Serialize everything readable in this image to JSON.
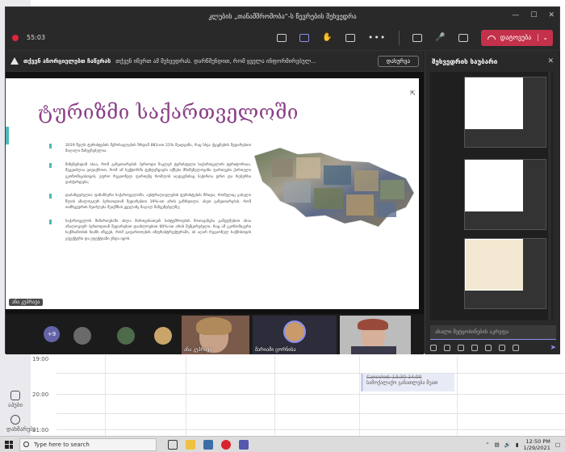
{
  "meeting": {
    "title": "კლუბის „თანამშრომობა“-ს წევრების შეხვედრა",
    "timer": "55:03",
    "leave_label": "დატოვება",
    "banner": {
      "bold": "თქვენ აჩორციელებთ ჩაწერას",
      "message": "თქვენ იწერთ ამ შეხვედრას. დარწმუნდით, რომ ყველა ინფორმირებულ...",
      "dismiss": "დახურვა"
    },
    "presenter_tag": "ანა კუპრავა"
  },
  "slide": {
    "title": "ტურიზმი საქართველოში",
    "bullets": [
      "2019 წელს ტურისტების შემოსავლების ზრდამ 883-ით 21% შეადგინა, რაც სხვა ქვეყნების შედარებით მაღალი მაჩვენებელია.",
      "მიზეზებიდან ისაა, რომ განვითარების პერიოდი ნაკლებ ტურისტული საქართველოს ტერიტორიაა, შეგვიძლია ვიფიქროთ, რომ ამ სექტორში ტენდენციები იქნება მნიშვნელოვანი ფართეები ქართული ეკონომიკისთვის, უფრო რეგიონულ ფართეზე რომლის აღდგენისაც საჭიროა დრო და რესურსი დასჭირდება;",
      "დაბანდებულია ფინანსური საქართველოში, ავსტრალიელების ტურისტების შრიდა, რომელიც გასული წლის ანალოგიურ პერიოდთან შედარებით 19%-ით არის გაზრდილი. ასეთ განვითარებას, რომ თანხვედრის შეიძლება შეიქმნას ყველაზე მაღალ მაჩვენებელზე;",
      "საქართველოს მიმართებაში ახლა მართვისათვის სასტუმროების შოთავაზება გამუდმებით ისაა ანალოგიურ პერიოდთან შედარებით დაახლოებით 60%-ით არის შემცირებული. რაც ამ ეკონომიკური საქმიანობის ზიანს იწვევს, რომ გაფართოების ინფრასტრუქტურაში, ის აღარ რეგიონულ საქმისთვის ეფექტური და ეფექტიანი უნდა იყოს."
    ]
  },
  "participants": {
    "overflow": "+9",
    "video1_name": "ანა კუპრავა",
    "video2_name": "მარიამი ცორნისა"
  },
  "chat": {
    "title": "შეხვედრის საუბარი",
    "input_placeholder": "ახალი შეტყობინების აკრეფა"
  },
  "calendar": {
    "times": [
      "19:00",
      "20:00",
      "21:00"
    ],
    "event": {
      "status": "Canceled: 13:30-14:00",
      "title": "სამოქალაქო განათლება მეათ"
    },
    "nav": [
      "აპები",
      "დახმარება"
    ]
  },
  "taskbar": {
    "search_placeholder": "Type here to search",
    "time": "12:50 PM",
    "date": "1/29/2021"
  }
}
